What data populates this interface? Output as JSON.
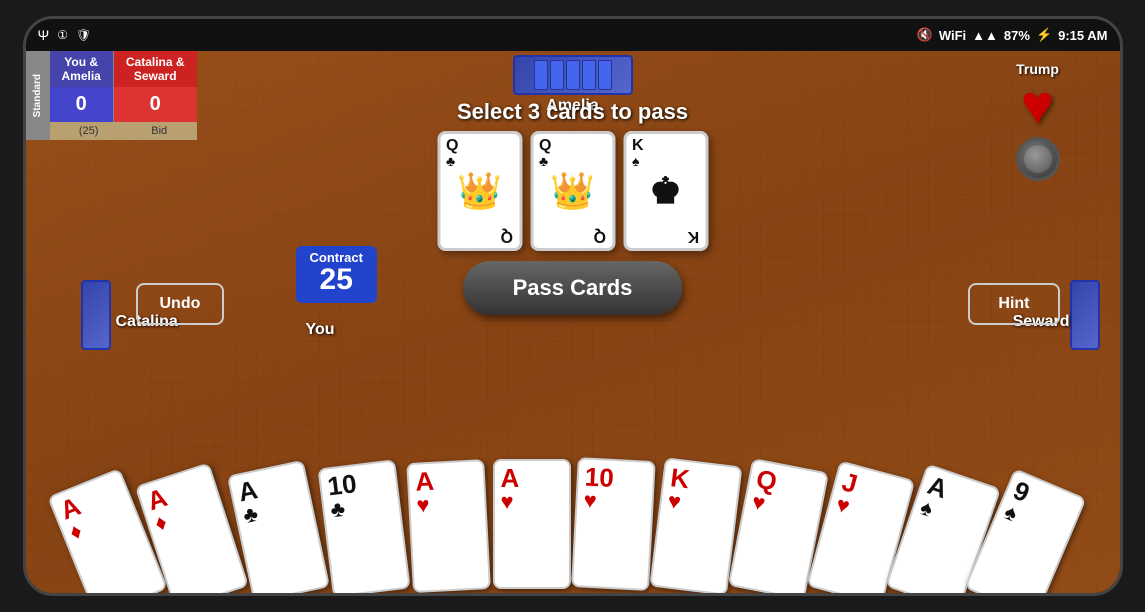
{
  "statusBar": {
    "time": "9:15 AM",
    "battery": "87%",
    "batteryIcon": "⚡",
    "wifiIcon": "WiFi",
    "signalIcon": "▲▲"
  },
  "scoreboard": {
    "sidebarLabel": "Standard",
    "team1": {
      "name": "You &\nAmelia",
      "score": "0"
    },
    "team2": {
      "name": "Catalina &\nSeward",
      "score": "0"
    },
    "subLabel1": "(25)",
    "subLabel2": "Bid"
  },
  "game": {
    "topPlayer": "Amelia",
    "leftPlayer": "Catalina",
    "rightPlayer": "Seward",
    "bottomPlayer": "You",
    "trumpLabel": "Trump",
    "trumpSuit": "♥",
    "selectText": "Select 3 cards to pass",
    "contractLabel": "Contract",
    "contractNum": "25",
    "passCardsBtn": "Pass Cards",
    "undoBtn": "Undo",
    "hintBtn": "Hint"
  },
  "selectedCards": [
    {
      "rank": "Q",
      "suit": "♣",
      "color": "black"
    },
    {
      "rank": "Q",
      "suit": "♣",
      "color": "black"
    },
    {
      "rank": "K",
      "suit": "♠",
      "color": "black"
    }
  ],
  "handCards": [
    {
      "rank": "A",
      "suit": "♦",
      "color": "red"
    },
    {
      "rank": "A",
      "suit": "♦",
      "color": "red"
    },
    {
      "rank": "A",
      "suit": "♣",
      "color": "black"
    },
    {
      "rank": "10",
      "suit": "♣",
      "color": "black"
    },
    {
      "rank": "A",
      "suit": "♥",
      "color": "red"
    },
    {
      "rank": "A",
      "suit": "♥",
      "color": "red"
    },
    {
      "rank": "10",
      "suit": "♥",
      "color": "red"
    },
    {
      "rank": "K",
      "suit": "♥",
      "color": "red"
    },
    {
      "rank": "Q",
      "suit": "♥",
      "color": "red"
    },
    {
      "rank": "J",
      "suit": "♥",
      "color": "red"
    },
    {
      "rank": "A",
      "suit": "♠",
      "color": "black"
    },
    {
      "rank": "9",
      "suit": "♠",
      "color": "black"
    }
  ]
}
